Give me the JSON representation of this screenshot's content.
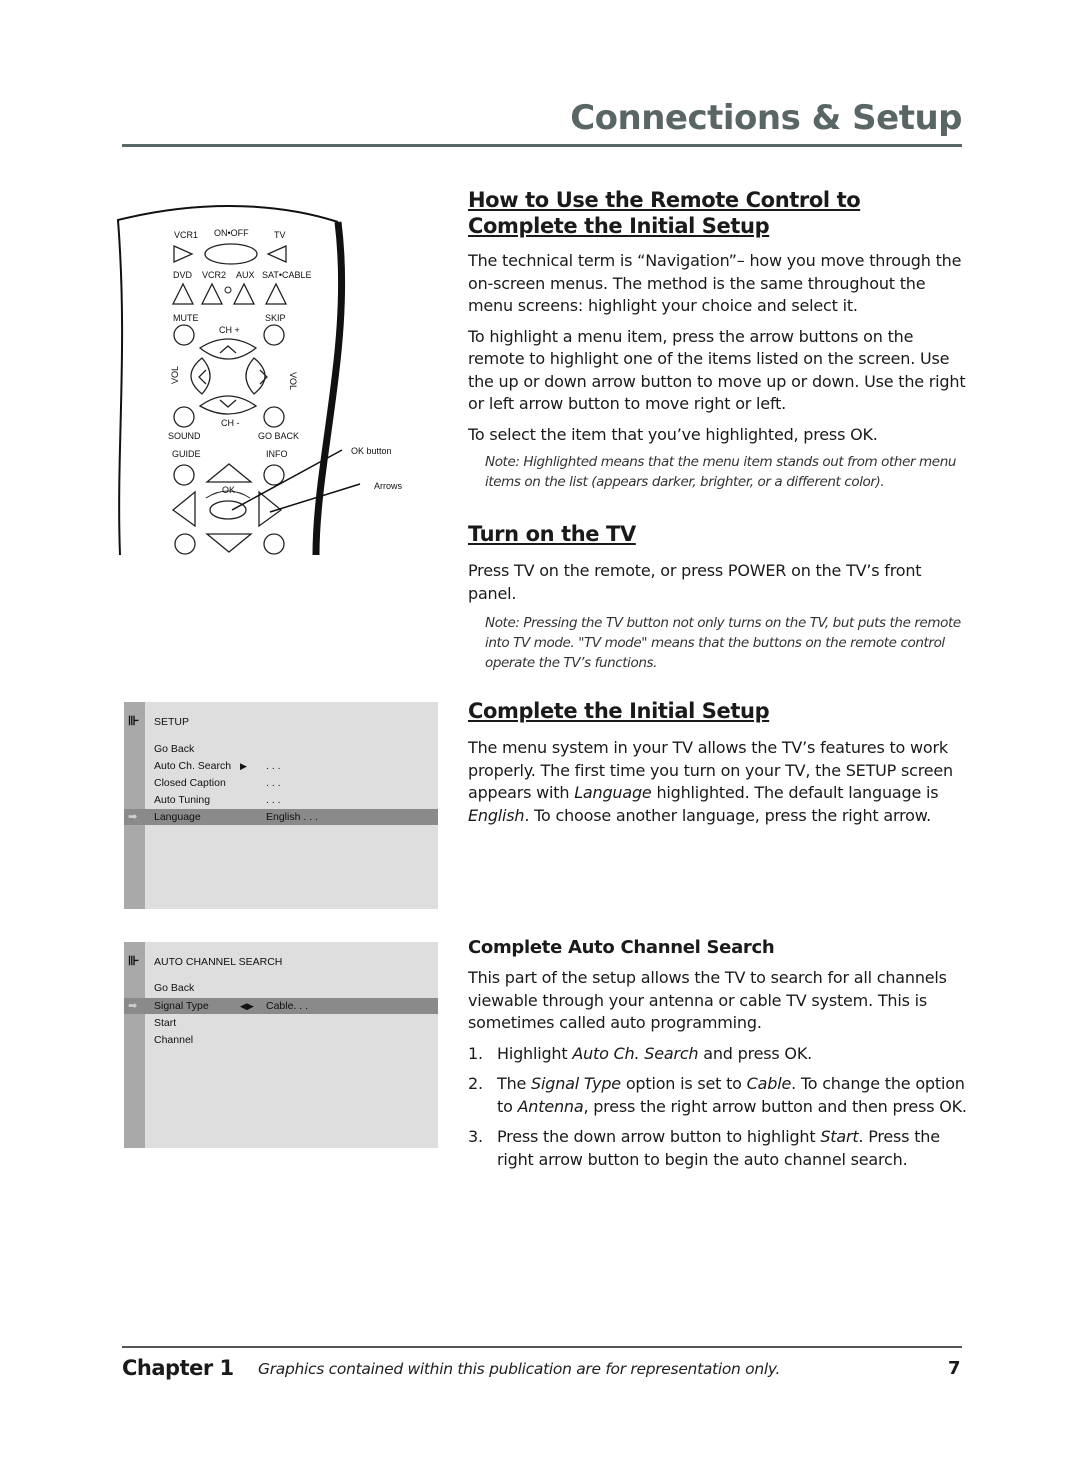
{
  "header": {
    "title": "Connections & Setup"
  },
  "remote": {
    "labels": {
      "vcr1": "VCR1",
      "on_off": "ON•OFF",
      "tv": "TV",
      "dvd": "DVD",
      "vcr2": "VCR2",
      "aux": "AUX",
      "sat_cable": "SAT•CABLE",
      "mute": "MUTE",
      "skip": "SKIP",
      "ch_plus": "CH +",
      "ch_minus": "CH -",
      "vol_left": "VOL",
      "vol_right": "VOL",
      "sound": "SOUND",
      "go_back": "GO  BACK",
      "guide": "GUIDE",
      "info": "INFO",
      "ok": "OK"
    },
    "callouts": {
      "ok_button": "OK button",
      "arrows": "Arrows"
    }
  },
  "setup_menu": {
    "title": "SETUP",
    "rows": [
      {
        "label": "Go Back",
        "marker": "",
        "value": ""
      },
      {
        "label": "Auto Ch. Search",
        "marker": "▶",
        "value": ". . ."
      },
      {
        "label": "Closed Caption",
        "marker": "",
        "value": ". . ."
      },
      {
        "label": "Auto Tuning",
        "marker": "",
        "value": ". . ."
      },
      {
        "label": "Language",
        "marker": "",
        "value": "English . . .",
        "highlighted": true
      }
    ],
    "highlight_arrow": "➡"
  },
  "auto_channel_menu": {
    "title": "AUTO CHANNEL SEARCH",
    "rows": [
      {
        "label": "Go Back",
        "marker": "",
        "value": ""
      },
      {
        "label": "Signal Type",
        "marker": "◀▶",
        "value": "Cable. . .",
        "highlighted": true
      },
      {
        "label": "Start",
        "marker": "",
        "value": ""
      },
      {
        "label": "Channel",
        "marker": "",
        "value": ""
      }
    ],
    "highlight_arrow": "➡"
  },
  "sections": {
    "remote_control": {
      "heading": "How to Use the Remote Control to Complete the Initial Setup",
      "para1": "The technical term is “Navigation”– how you move through the on-screen menus. The method is the same throughout the menu screens: highlight your choice and select it.",
      "para2": "To highlight a menu item, press the arrow buttons on the remote to highlight one of the items listed on the screen. Use the up or down arrow button to move up or down. Use the right or left arrow button to move right or left.",
      "para3": "To select the item that you’ve highlighted, press OK.",
      "note": "Note: Highlighted means that the menu item stands out from other menu items on the list (appears darker, brighter, or a different color)."
    },
    "turn_on": {
      "heading": "Turn on the TV",
      "para": "Press TV on the remote, or press POWER on the TV’s front panel.",
      "note": "Note: Pressing the TV button not only turns on the TV, but puts the remote into TV mode. \"TV mode\" means that the buttons on the remote control operate the TV’s functions."
    },
    "initial_setup": {
      "heading": "Complete the Initial Setup",
      "para_part1": "The menu system in your TV allows the TV’s features to work properly. The first time you turn on your TV, the SETUP screen appears with ",
      "para_em1": "Language",
      "para_part2": " highlighted. The default language is ",
      "para_em2": "English",
      "para_part3": ". To choose another language, press the right arrow."
    },
    "auto_channel": {
      "heading": "Complete Auto Channel Search",
      "para": "This part of the setup allows the TV to search for all channels viewable through your antenna or cable TV system. This is sometimes called auto programming.",
      "steps": [
        {
          "num": "1.",
          "t1": "Highlight ",
          "e1": "Auto Ch. Search",
          "t2": " and press OK.",
          "e2": "",
          "t3": "",
          "e3": "",
          "t4": ""
        },
        {
          "num": "2.",
          "t1": "The ",
          "e1": "Signal Type",
          "t2": " option is set to ",
          "e2": "Cable",
          "t3": ". To change the option to ",
          "e3": "Antenna",
          "t4": ", press the right arrow button and then press OK."
        },
        {
          "num": "3.",
          "t1": "Press the down arrow button to highlight ",
          "e1": "Start",
          "t2": ". Press the right arrow button to begin the auto channel search.",
          "e2": "",
          "t3": "",
          "e3": "",
          "t4": ""
        }
      ]
    }
  },
  "footer": {
    "chapter": "Chapter 1",
    "disclaimer": "Graphics contained within this publication are for representation only.",
    "page_number": "7"
  }
}
